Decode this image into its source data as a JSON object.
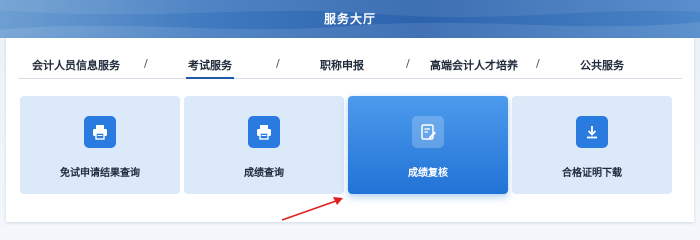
{
  "banner": {
    "title": "服务大厅"
  },
  "tabs": [
    {
      "label": "会计人员信息服务"
    },
    {
      "label": "考试服务"
    },
    {
      "label": "职称申报"
    },
    {
      "label": "高端会计人才培养"
    },
    {
      "label": "公共服务"
    }
  ],
  "separator": "/",
  "active_tab": "考试服务",
  "cards": [
    {
      "label": "免试申请结果查询",
      "icon": "printer-icon"
    },
    {
      "label": "成绩查询",
      "icon": "printer-icon"
    },
    {
      "label": "成绩复核",
      "icon": "edit-document-icon"
    },
    {
      "label": "合格证明下载",
      "icon": "download-icon"
    }
  ],
  "active_card": "成绩复核",
  "colors": {
    "accent": "#2273d6",
    "card_bg": "#dbe9f8",
    "annotation": "#e02020"
  }
}
